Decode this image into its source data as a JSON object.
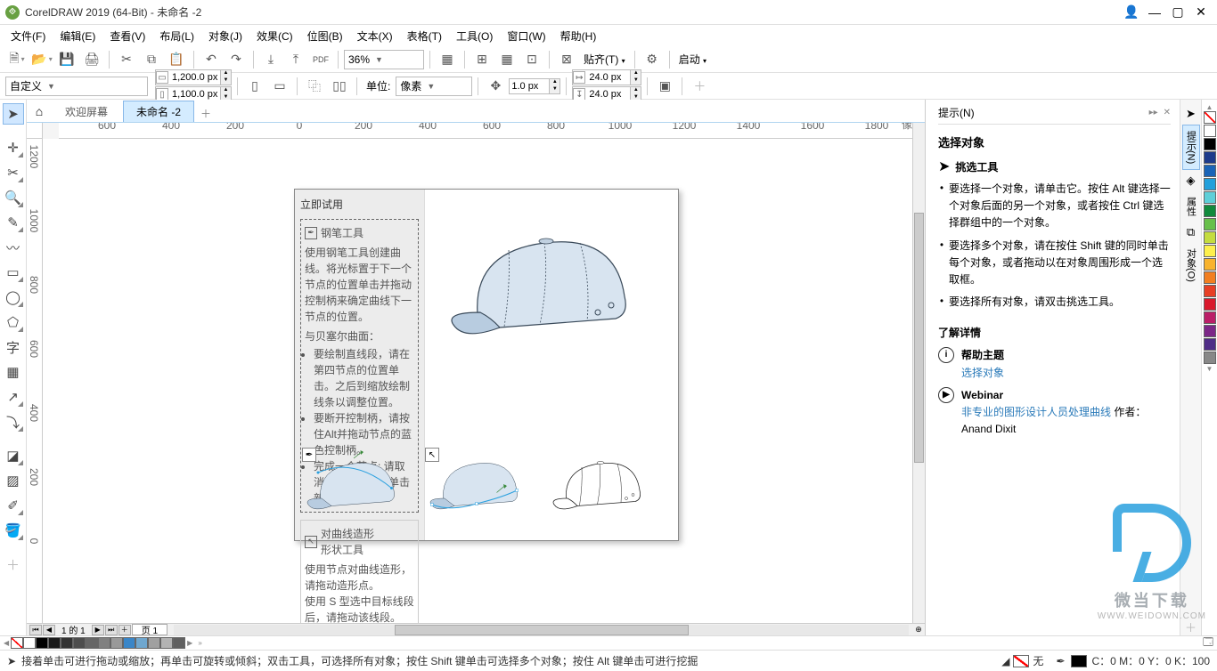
{
  "title": "CorelDRAW 2019 (64-Bit) - 未命名 -2",
  "menu": [
    "文件(F)",
    "编辑(E)",
    "查看(V)",
    "布局(L)",
    "对象(J)",
    "效果(C)",
    "位图(B)",
    "文本(X)",
    "表格(T)",
    "工具(O)",
    "窗口(W)",
    "帮助(H)"
  ],
  "zoom": "36%",
  "snap_label": "贴齐(T)",
  "launch_label": "启动",
  "preset": "自定义",
  "page_w": "1,200.0 px",
  "page_h": "1,100.0 px",
  "units_label": "单位:",
  "units_value": "像素",
  "nudge": "1.0 px",
  "dup_x": "24.0 px",
  "dup_y": "24.0 px",
  "tabs": {
    "home": "⌂",
    "welcome": "欢迎屏幕",
    "doc": "未命名 -2"
  },
  "ruler_h": [
    "600",
    "400",
    "200",
    "0",
    "200",
    "400",
    "600",
    "800",
    "1000",
    "1200",
    "1400",
    "1600",
    "1800"
  ],
  "ruler_h_unit": "像素",
  "ruler_v": [
    "1200",
    "1000",
    "800",
    "600",
    "400",
    "200",
    "0"
  ],
  "sidepanel": {
    "title": "立即试用",
    "block1": {
      "name": "钢笔工具",
      "body": "使用钢笔工具创建曲线。将光标置于下一个节点的位置单击并拖动控制柄来确定曲线下一节点的位置。",
      "sub": "与贝塞尔曲面：",
      "pts": [
        "要绘制直线段，请在第四节点的位置单击。之后到缩放绘制线条以调整位置。",
        "要断开控制柄，请按住Alt并拖动节点的蓝色控制柄。",
        "完成一个节点: 请取消选节点，然后单击新位置。"
      ]
    },
    "block2": {
      "name": "对曲线造形\n形状工具",
      "body": "使用节点对曲线造形，请拖动造形点。\n使用 S 型选中目标线段后，请拖动该线段。"
    }
  },
  "pager": {
    "count": "1 的 1",
    "page1": "页 1"
  },
  "docker": {
    "title": "提示(N)",
    "section_title": "选择对象",
    "tool_name": "挑选工具",
    "bullets": [
      "要选择一个对象，请单击它。按住 Alt 键选择一个对象后面的另一个对象，或者按住 Ctrl 键选择群组中的一个对象。",
      "要选择多个对象，请在按住 Shift 键的同时单击每个对象，或者拖动以在对象周围形成一个选取框。",
      "要选择所有对象，请双击挑选工具。"
    ],
    "learn_title": "了解详情",
    "help_topic": "帮助主题",
    "help_link": "选择对象",
    "webinar": "Webinar",
    "webinar_link": "非专业的图形设计人员处理曲线",
    "webinar_author": "作者：Anand Dixit"
  },
  "sidetabs": [
    "提示(N)",
    "属性",
    "对象(O)"
  ],
  "colors": [
    "#FFFFFF",
    "#000000",
    "#1d3b8b",
    "#1a64b7",
    "#23a0db",
    "#5ecfd8",
    "#118a3c",
    "#68c04a",
    "#c4dc3f",
    "#fdf04d",
    "#f8b32d",
    "#f27f21",
    "#e73f25",
    "#d9182b",
    "#bb1e68",
    "#7c2787",
    "#4f2c86",
    "#888888"
  ],
  "palette_h": [
    "none",
    "#FFFFFF",
    "#000000",
    "#1a1a1a",
    "#333333",
    "#4d4d4d",
    "#666666",
    "#808080",
    "#999999",
    "#3a86c8",
    "#6fa7cf",
    "#a0a0a0",
    "#b3b3b3",
    "#606060"
  ],
  "status": {
    "hint": "接着单击可进行拖动或缩放；再单击可旋转或倾斜；双击工具，可选择所有对象；按住 Shift 键单击可选择多个对象；按住 Alt 键单击可进行挖掘",
    "fill_none": "无",
    "cmyk": "C：0 M：0 Y：0 K：100"
  },
  "watermark": {
    "big": "微当下载",
    "url": "WWW.WEIDOWN.COM"
  }
}
